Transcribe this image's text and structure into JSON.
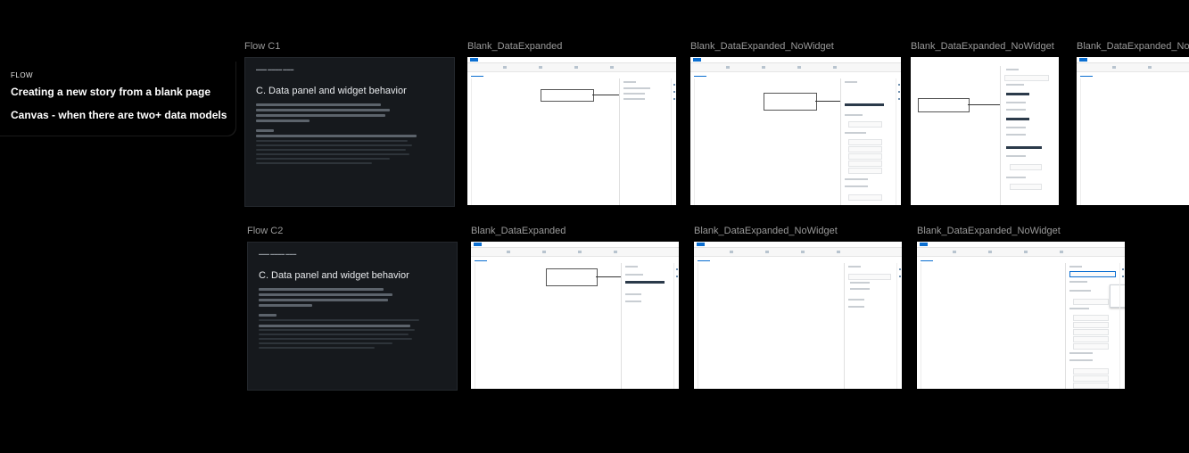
{
  "sidebar": {
    "label": "FLOW",
    "title_1": "Creating a new story from a blank page",
    "title_2": "Canvas - when there are two+ data models"
  },
  "rows": [
    {
      "flow_title": "Flow C1",
      "frames": [
        "Blank_DataExpanded",
        "Blank_DataExpanded_NoWidget",
        "Blank_DataExpanded_NoWidget",
        "Blank_DataExpanded_NoWidget"
      ]
    },
    {
      "flow_title": "Flow C2",
      "frames": [
        "Blank_DataExpanded",
        "Blank_DataExpanded_NoWidget",
        "Blank_DataExpanded_NoWidget"
      ]
    }
  ],
  "description_card": {
    "heading": "C. Data panel and widget behavior"
  },
  "colors": {
    "background": "#000000",
    "dark_frame": "#16191d",
    "accent": "#0a6ed1"
  }
}
